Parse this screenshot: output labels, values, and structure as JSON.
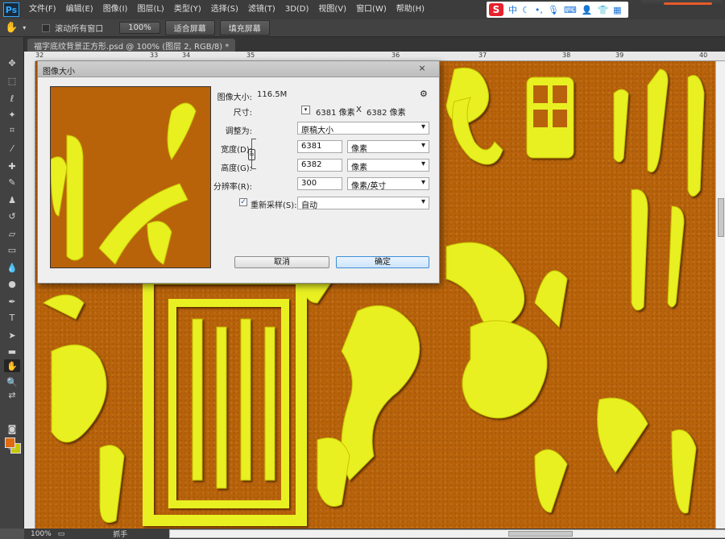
{
  "app": {
    "logo": "Ps"
  },
  "menu": [
    "文件(F)",
    "编辑(E)",
    "图像(I)",
    "图层(L)",
    "类型(Y)",
    "选择(S)",
    "滤镜(T)",
    "3D(D)",
    "视图(V)",
    "窗口(W)",
    "帮助(H)"
  ],
  "ime": {
    "logo": "S",
    "mode": "中"
  },
  "options_bar": {
    "scroll_all_label": "滚动所有窗口",
    "zoom_100": "100%",
    "fit_screen": "适合屏幕",
    "fill_screen": "填充屏幕"
  },
  "document_tab": "福字底纹背景正方形.psd @ 100% (图层 2, RGB/8) *",
  "ruler_top_ticks": [
    "32",
    "33",
    "34",
    "35",
    "36",
    "37",
    "38",
    "39",
    "40"
  ],
  "statusbar": {
    "zoom": "100%",
    "tool_hint": "抓手"
  },
  "dialog": {
    "title": "图像大小",
    "close": "×",
    "size_label": "图像大小:",
    "size_value": "116.5M",
    "dims_label": "尺寸:",
    "dims_width": "6381 像素",
    "dims_x": "X",
    "dims_height": "6382 像素",
    "fit_label": "调整为:",
    "fit_value": "原稿大小",
    "width_label": "宽度(D):",
    "width_value": "6381",
    "width_unit": "像素",
    "height_label": "高度(G):",
    "height_value": "6382",
    "height_unit": "像素",
    "resolution_label": "分辨率(R):",
    "resolution_value": "300",
    "resolution_unit": "像素/英寸",
    "resample_label": "重新采样(S):",
    "resample_value": "自动",
    "cancel": "取消",
    "ok": "确定",
    "gear": "⚙"
  },
  "colors": {
    "foreground": "#e06a10",
    "background": "#c8c800",
    "canvas": "#b8620a",
    "glyph": "#e6f01a"
  }
}
